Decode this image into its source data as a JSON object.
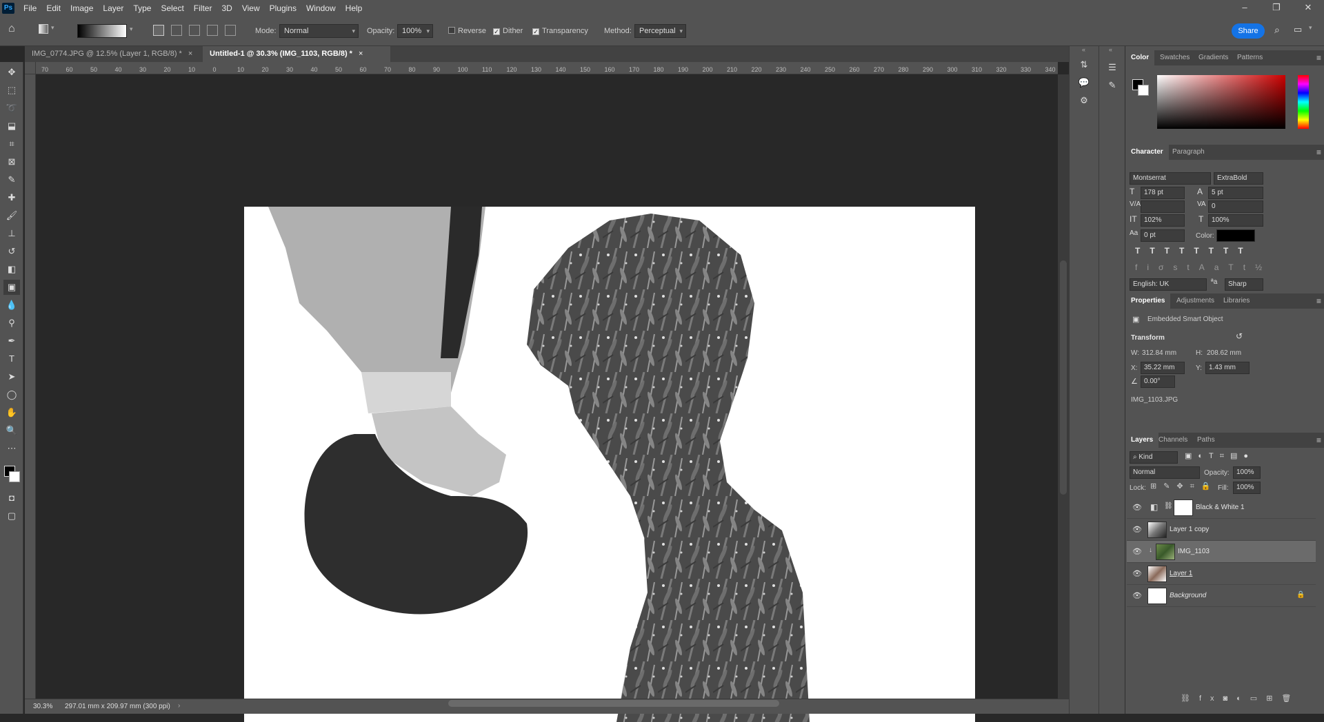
{
  "app": {
    "logo": "Ps"
  },
  "menu": [
    "File",
    "Edit",
    "Image",
    "Layer",
    "Type",
    "Select",
    "Filter",
    "3D",
    "View",
    "Plugins",
    "Window",
    "Help"
  ],
  "options": {
    "mode_label": "Mode:",
    "mode_value": "Normal",
    "opacity_label": "Opacity:",
    "opacity_value": "100%",
    "reverse_label": "Reverse",
    "dither_label": "Dither",
    "transparency_label": "Transparency",
    "method_label": "Method:",
    "method_value": "Perceptual",
    "share_label": "Share"
  },
  "tabs": [
    {
      "label": "IMG_0774.JPG @ 12.5% (Layer 1, RGB/8) *",
      "active": false
    },
    {
      "label": "Untitled-1 @ 30.3% (IMG_1103, RGB/8) *",
      "active": true
    }
  ],
  "ruler_ticks": [
    "70",
    "60",
    "50",
    "40",
    "30",
    "20",
    "10",
    "0",
    "10",
    "20",
    "30",
    "40",
    "50",
    "60",
    "70",
    "80",
    "90",
    "100",
    "110",
    "120",
    "130",
    "140",
    "150",
    "160",
    "170",
    "180",
    "190",
    "200",
    "210",
    "220",
    "230",
    "240",
    "250",
    "260",
    "270",
    "280",
    "290",
    "300",
    "310",
    "320",
    "330",
    "340"
  ],
  "status": {
    "zoom": "30.3%",
    "doc_info": "297.01 mm x 209.97 mm (300 ppi)"
  },
  "color_panel": {
    "tabs": [
      "Color",
      "Swatches",
      "Gradients",
      "Patterns"
    ]
  },
  "character_panel": {
    "tabs": [
      "Character",
      "Paragraph"
    ],
    "font_family": "Montserrat",
    "font_style": "ExtraBold",
    "font_size": "178 pt",
    "leading": "5 pt",
    "kerning": "",
    "tracking": "0",
    "vertical_scale": "102%",
    "horizontal_scale": "100%",
    "baseline_shift": "0 pt",
    "color_label": "Color:",
    "language": "English: UK",
    "antialias": "Sharp"
  },
  "properties_panel": {
    "tabs": [
      "Properties",
      "Adjustments",
      "Libraries"
    ],
    "type_label": "Embedded Smart Object",
    "transform_label": "Transform",
    "w_label": "W:",
    "w_value": "312.84 mm",
    "h_label": "H:",
    "h_value": "208.62 mm",
    "x_label": "X:",
    "x_value": "35.22 mm",
    "y_label": "Y:",
    "y_value": "1.43 mm",
    "angle_value": "0.00°",
    "source_file": "IMG_1103.JPG"
  },
  "layers_panel": {
    "tabs": [
      "Layers",
      "Channels",
      "Paths"
    ],
    "kind_label": "Kind",
    "blend_mode": "Normal",
    "opacity_label": "Opacity:",
    "opacity_value": "100%",
    "lock_label": "Lock:",
    "fill_label": "Fill:",
    "fill_value": "100%",
    "layers": [
      {
        "name": "Black & White 1",
        "selected": false
      },
      {
        "name": "Layer 1 copy",
        "selected": false
      },
      {
        "name": "IMG_1103",
        "selected": true
      },
      {
        "name": "Layer 1",
        "selected": false
      },
      {
        "name": "Background",
        "selected": false
      }
    ]
  }
}
